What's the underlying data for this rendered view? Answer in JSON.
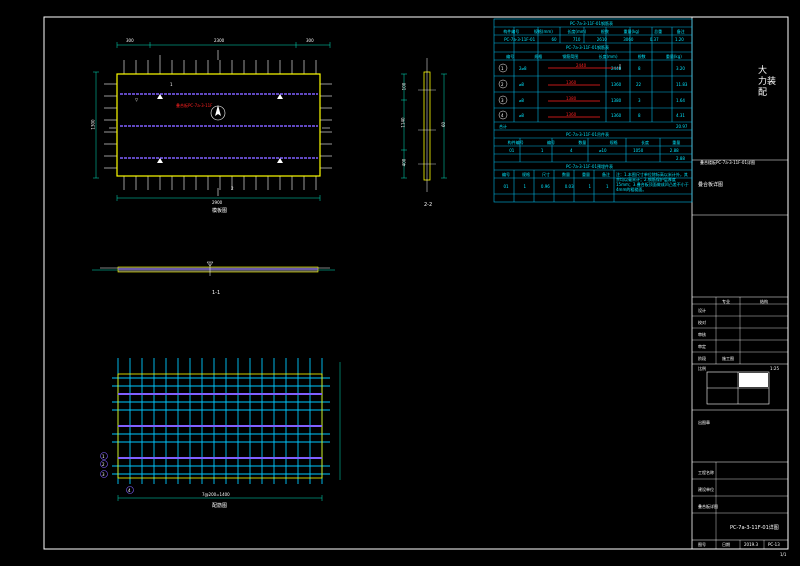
{
  "schedule_table": {
    "title": "PC-7a-3-11F-01钢筋表",
    "header": [
      "构件编号",
      "规格(mm)",
      "长度(mm)",
      "根数",
      "重量(kg)",
      "总重",
      "备注"
    ],
    "header_values": [
      "PC-7a-3-11F-01",
      "60",
      "710",
      "2610",
      "3060",
      "0.37",
      "1.20"
    ],
    "subtitle": "PC-7a-3-11F-01钢筋表",
    "col_headers": [
      "编号",
      "规格",
      "钢筋简图",
      "长度(mm)",
      "根数",
      "重量(kg)"
    ],
    "rows": [
      {
        "id": "1",
        "spec": "2⌀8",
        "bar_label": "2440",
        "len": "2440",
        "qty": "8",
        "wt": "3.20"
      },
      {
        "id": "2",
        "spec": "⌀8",
        "bar_label": "1360",
        "len": "1360",
        "qty": "22",
        "wt": "11.83"
      },
      {
        "id": "3",
        "spec": "⌀8",
        "bar_label": "1380",
        "len": "1380",
        "qty": "3",
        "wt": "1.64"
      },
      {
        "id": "4",
        "spec": "⌀8",
        "bar_label": "1360",
        "len": "1360",
        "qty": "8",
        "wt": "4.31"
      }
    ],
    "total_label": "合计",
    "total_value": "20.97",
    "sub_table2_title": "PC-7a-3-11F-01吊件表",
    "sub_table2_header": [
      "构件编号",
      "编号",
      "数量",
      "规格",
      "长度",
      "重量"
    ],
    "sub_table2_row": [
      "01",
      "1",
      "4",
      "⌀10",
      "1050",
      "2.88"
    ],
    "sub_table2_total": "2.88",
    "sub_table3_title": "PC-7a-3-11F-01预埋件表",
    "sub_table3_header": [
      "编号",
      "规格",
      "尺寸",
      "数量",
      "重量",
      "备注"
    ],
    "sub_table3_row": [
      "01",
      "1",
      "0.96",
      "0.03",
      "1",
      "1"
    ],
    "note": "注：1.本图尺寸单位除标高以米计外，其余均以毫米计；2.钢筋保护层厚度15mm；3.叠合板顶面做成凹凸差不小于4mm的粗糙面。"
  },
  "title_block": {
    "project": "大\n力装\n配",
    "caption": "叠合板详图",
    "caption2": "叠合楼板PC-7a-3-11F-01详图",
    "design_label": "设计",
    "check_label": "校对",
    "review_label": "审核",
    "approve_label": "审定",
    "drawing_title": "PC-7a-3-11F-01详图",
    "sheet_label": "图号",
    "sheet_value": "PC-13",
    "scale_label": "比例",
    "scale_value": "1:25",
    "date_label": "日期",
    "date_value": "2019.3",
    "phase_label": "阶段",
    "phase_value": "施工图",
    "project_name_label": "工程名称",
    "unit_label": "建设单位",
    "profession_label": "专业",
    "profession_value": "结构",
    "stamp_label": "出图章"
  },
  "plan_view": {
    "title": "模板图",
    "dims_top": [
      "300",
      "2300",
      "300"
    ],
    "dim_left": "1300",
    "overall_bottom": "2900",
    "red_note": "叠合板PC-7a-3-11F",
    "section_mark_1": "1",
    "section_mark_2": "2",
    "level_mark": "▽"
  },
  "section_1": {
    "title": "1-1"
  },
  "section_2": {
    "title": "2-2",
    "dims": [
      "100",
      "1140",
      "400",
      "60"
    ]
  },
  "rebar_view": {
    "title": "配筋图",
    "bottom_dim": "7@200=1400",
    "labels": [
      "1",
      "2",
      "3",
      "4"
    ]
  },
  "page_number": "1/1"
}
